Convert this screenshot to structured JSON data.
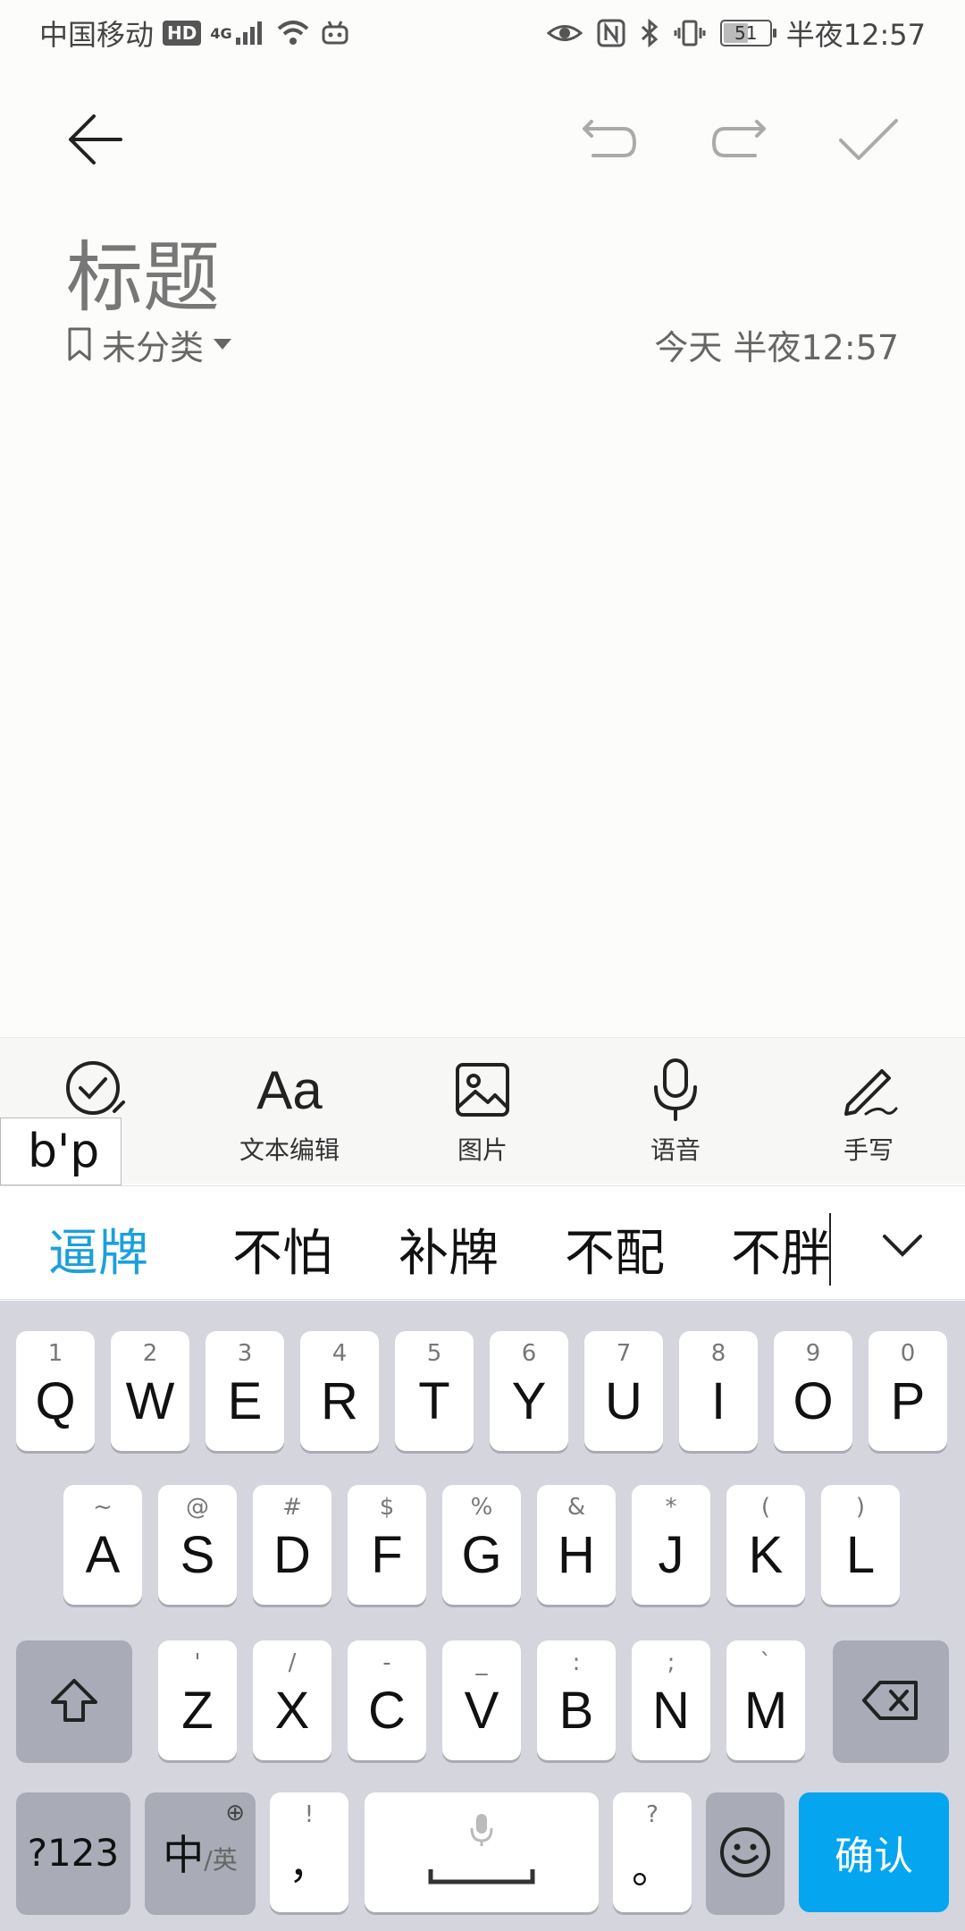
{
  "status_bar": {
    "carrier": "中国移动",
    "hd": "HD",
    "network": "4G",
    "battery": "51",
    "battery_level": 0.51,
    "time": "半夜12:57"
  },
  "toolbar": {
    "back_icon": "arrow-left-icon",
    "undo_icon": "undo-icon",
    "redo_icon": "redo-icon",
    "confirm_icon": "check-icon"
  },
  "note": {
    "title": "标题",
    "category": "未分类",
    "date": "今天 半夜12:57"
  },
  "note_tools": {
    "checklist_label": "清单",
    "text_label": "文本编辑",
    "text_icon": "Aa",
    "image_label": "图片",
    "voice_label": "语音",
    "handwrite_label": "手写"
  },
  "composing": "b'p",
  "candidates": [
    "逼牌",
    "不怕",
    "补牌",
    "不配",
    "不胖"
  ],
  "keyboard": {
    "row1": [
      {
        "k": "Q",
        "s": "1"
      },
      {
        "k": "W",
        "s": "2"
      },
      {
        "k": "E",
        "s": "3"
      },
      {
        "k": "R",
        "s": "4"
      },
      {
        "k": "T",
        "s": "5"
      },
      {
        "k": "Y",
        "s": "6"
      },
      {
        "k": "U",
        "s": "7"
      },
      {
        "k": "I",
        "s": "8"
      },
      {
        "k": "O",
        "s": "9"
      },
      {
        "k": "P",
        "s": "0"
      }
    ],
    "row2": [
      {
        "k": "A",
        "s": "~"
      },
      {
        "k": "S",
        "s": "@"
      },
      {
        "k": "D",
        "s": "#"
      },
      {
        "k": "F",
        "s": "$"
      },
      {
        "k": "G",
        "s": "%"
      },
      {
        "k": "H",
        "s": "&"
      },
      {
        "k": "J",
        "s": "*"
      },
      {
        "k": "K",
        "s": "("
      },
      {
        "k": "L",
        "s": ")"
      }
    ],
    "row3": [
      {
        "k": "Z",
        "s": "'"
      },
      {
        "k": "X",
        "s": "/"
      },
      {
        "k": "C",
        "s": "-"
      },
      {
        "k": "V",
        "s": "_"
      },
      {
        "k": "B",
        "s": ":"
      },
      {
        "k": "N",
        "s": ";"
      },
      {
        "k": "M",
        "s": "`"
      }
    ],
    "symbols_label": "?123",
    "lang_main": "中",
    "lang_sub": "/英",
    "comma_main": "，",
    "comma_sub": "!",
    "period_main": "。",
    "period_sub": "?",
    "enter_label": "确认"
  }
}
